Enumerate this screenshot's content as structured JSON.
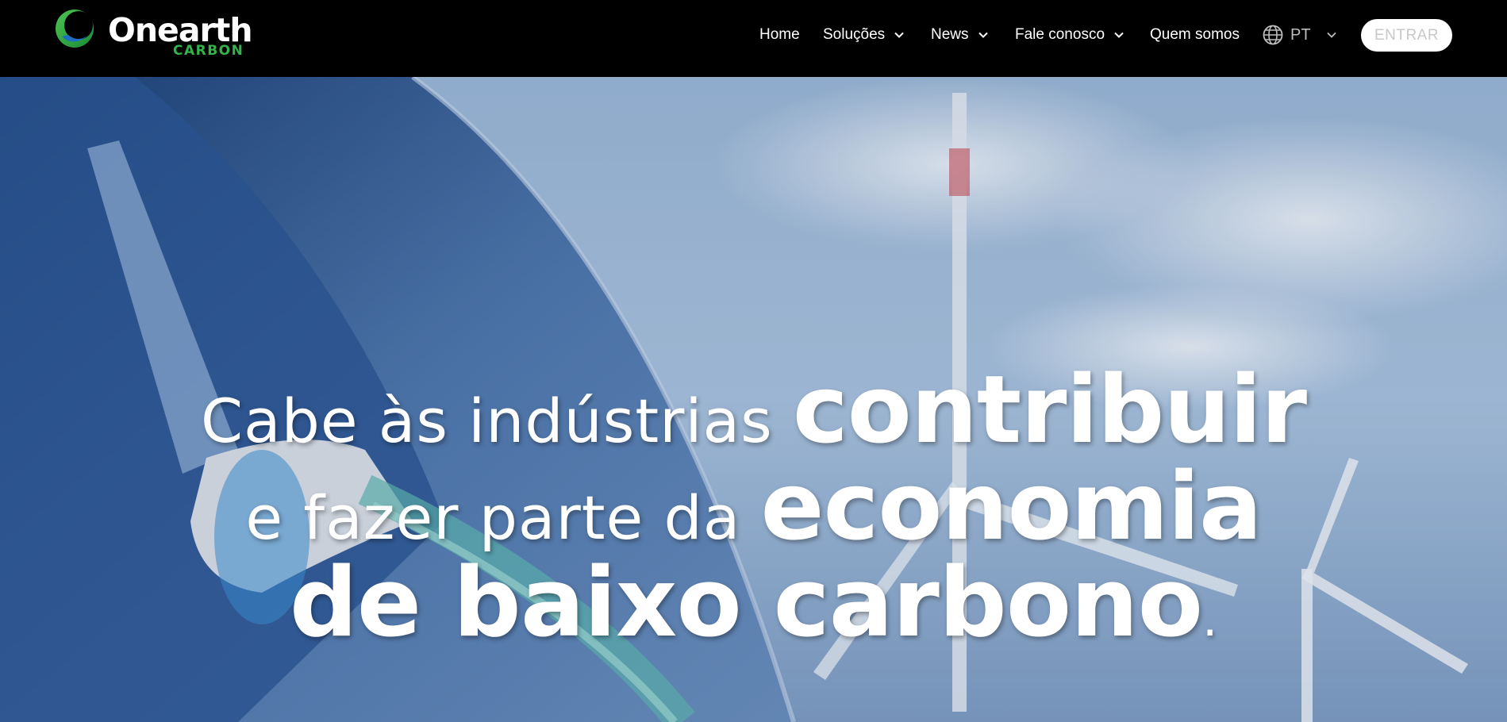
{
  "brand": {
    "name": "Onearth",
    "sub": "CARBON",
    "colors": {
      "green": "#33b44a",
      "blue": "#1e6fc2"
    }
  },
  "nav": {
    "home": "Home",
    "solutions": "Soluções",
    "news": "News",
    "contact": "Fale conosco",
    "about": "Quem somos",
    "language": "PT",
    "enter": "ENTRAR"
  },
  "hero": {
    "line1_light": "Cabe às indústrias ",
    "line1_bold": "contribuir",
    "line2_light": "e fazer parte da ",
    "line2_bold": "economia",
    "line3_bold": "de baixo carbono",
    "line3_dot": "."
  },
  "icons": [
    "onearth-logo-icon",
    "chevron-down-icon",
    "globe-icon"
  ]
}
